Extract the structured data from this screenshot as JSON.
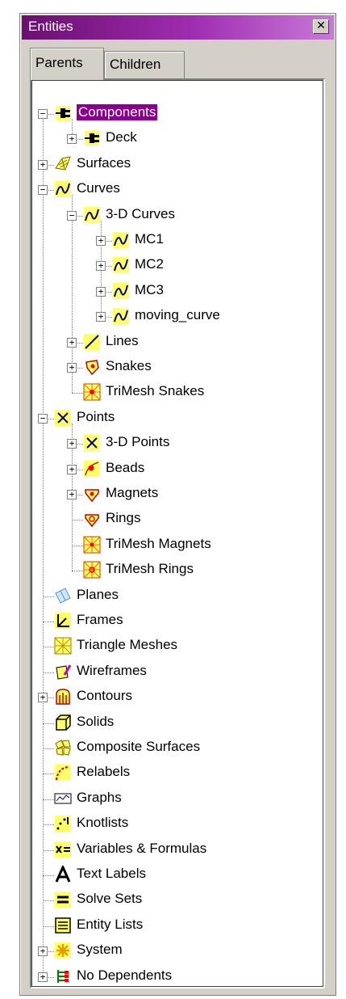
{
  "window": {
    "title": "Entities",
    "close_glyph": "✕"
  },
  "tabs": [
    {
      "label": "Parents",
      "active": true
    },
    {
      "label": "Children",
      "active": false
    }
  ],
  "tree": [
    {
      "label": "Components",
      "level": 0,
      "toggle": "-",
      "icon": "connector-icon",
      "selected": true
    },
    {
      "label": "Deck",
      "level": 1,
      "toggle": "+",
      "icon": "connector-icon"
    },
    {
      "label": "Surfaces",
      "level": 0,
      "toggle": "+",
      "icon": "surface-icon"
    },
    {
      "label": "Curves",
      "level": 0,
      "toggle": "-",
      "icon": "curve-icon"
    },
    {
      "label": "3-D Curves",
      "level": 1,
      "toggle": "-",
      "icon": "curve-icon"
    },
    {
      "label": "MC1",
      "level": 2,
      "toggle": "+",
      "icon": "curve-icon"
    },
    {
      "label": "MC2",
      "level": 2,
      "toggle": "+",
      "icon": "curve-icon"
    },
    {
      "label": "MC3",
      "level": 2,
      "toggle": "+",
      "icon": "curve-icon"
    },
    {
      "label": "moving_curve",
      "level": 2,
      "toggle": "+",
      "icon": "curve-icon"
    },
    {
      "label": "Lines",
      "level": 1,
      "toggle": "+",
      "icon": "line-icon"
    },
    {
      "label": "Snakes",
      "level": 1,
      "toggle": "+",
      "icon": "snake-icon"
    },
    {
      "label": "TriMesh Snakes",
      "level": 1,
      "toggle": "",
      "icon": "trimesh-snake-icon"
    },
    {
      "label": "Points",
      "level": 0,
      "toggle": "-",
      "icon": "point-icon"
    },
    {
      "label": "3-D Points",
      "level": 1,
      "toggle": "+",
      "icon": "point-icon"
    },
    {
      "label": "Beads",
      "level": 1,
      "toggle": "+",
      "icon": "bead-icon"
    },
    {
      "label": "Magnets",
      "level": 1,
      "toggle": "+",
      "icon": "magnet-icon"
    },
    {
      "label": "Rings",
      "level": 1,
      "toggle": "",
      "icon": "ring-icon"
    },
    {
      "label": "TriMesh Magnets",
      "level": 1,
      "toggle": "",
      "icon": "trimesh-magnet-icon"
    },
    {
      "label": "TriMesh Rings",
      "level": 1,
      "toggle": "",
      "icon": "trimesh-ring-icon"
    },
    {
      "label": "Planes",
      "level": 0,
      "toggle": "",
      "icon": "plane-icon"
    },
    {
      "label": "Frames",
      "level": 0,
      "toggle": "",
      "icon": "frame-icon"
    },
    {
      "label": "Triangle Meshes",
      "level": 0,
      "toggle": "",
      "icon": "triangle-mesh-icon"
    },
    {
      "label": "Wireframes",
      "level": 0,
      "toggle": "",
      "icon": "wireframe-icon"
    },
    {
      "label": "Contours",
      "level": 0,
      "toggle": "+",
      "icon": "contour-icon"
    },
    {
      "label": "Solids",
      "level": 0,
      "toggle": "",
      "icon": "solid-icon"
    },
    {
      "label": "Composite Surfaces",
      "level": 0,
      "toggle": "",
      "icon": "composite-surface-icon"
    },
    {
      "label": "Relabels",
      "level": 0,
      "toggle": "",
      "icon": "relabel-icon"
    },
    {
      "label": "Graphs",
      "level": 0,
      "toggle": "",
      "icon": "graph-icon"
    },
    {
      "label": "Knotlists",
      "level": 0,
      "toggle": "",
      "icon": "knotlist-icon"
    },
    {
      "label": "Variables & Formulas",
      "level": 0,
      "toggle": "",
      "icon": "variable-icon"
    },
    {
      "label": "Text Labels",
      "level": 0,
      "toggle": "",
      "icon": "text-label-icon"
    },
    {
      "label": "Solve Sets",
      "level": 0,
      "toggle": "",
      "icon": "solve-set-icon"
    },
    {
      "label": "Entity Lists",
      "level": 0,
      "toggle": "",
      "icon": "entity-list-icon"
    },
    {
      "label": "System",
      "level": 0,
      "toggle": "+",
      "icon": "system-icon"
    },
    {
      "label": "No Dependents",
      "level": 0,
      "toggle": "+",
      "icon": "no-dependents-icon"
    }
  ],
  "colors": {
    "title_start": "#6a0f6f",
    "selection": "#8b008b",
    "icon_yellow": "#ffff66"
  }
}
